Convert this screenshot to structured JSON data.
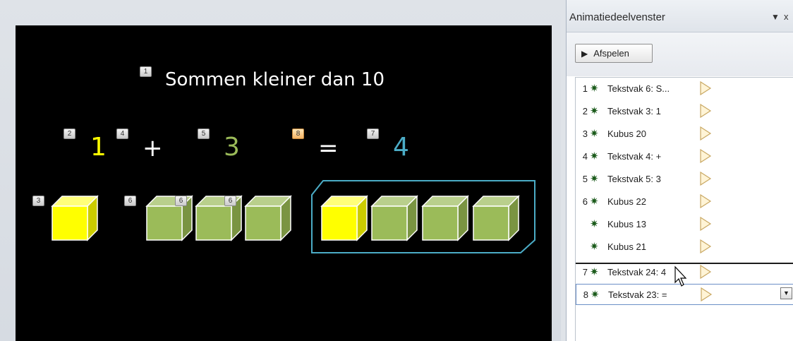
{
  "slide": {
    "title": "Sommen kleiner dan 10",
    "equation": {
      "a": "1",
      "plus": "+",
      "b": "3",
      "equals": "=",
      "result": "4"
    },
    "tags": {
      "t1": "1",
      "t2": "2",
      "t3": "3",
      "t4": "4",
      "t5": "5",
      "t6a": "6",
      "t6b": "6",
      "t6c": "6",
      "t7": "7",
      "t8": "8"
    },
    "colors": {
      "background": "#000000",
      "yellow": "#ffff00",
      "green": "#9bbb59",
      "teal": "#4bacc6"
    }
  },
  "pane": {
    "title": "Animatiedeelvenster",
    "menu_icon": "dropdown-triangle-icon",
    "close_label": "x",
    "play_button": {
      "icon": "play-icon",
      "label": "Afspelen"
    },
    "items": [
      {
        "num": "1",
        "label": "Tekstvak 6: S..."
      },
      {
        "num": "2",
        "label": "Tekstvak 3: 1"
      },
      {
        "num": "3",
        "label": "Kubus 20"
      },
      {
        "num": "4",
        "label": "Tekstvak 4: +"
      },
      {
        "num": "5",
        "label": "Tekstvak 5: 3"
      },
      {
        "num": "6",
        "label": "Kubus 22"
      },
      {
        "num": "",
        "label": "Kubus 13"
      },
      {
        "num": "",
        "label": "Kubus 21"
      },
      {
        "num": "7",
        "label": "Tekstvak 24: 4"
      },
      {
        "num": "8",
        "label": "Tekstvak 23: ="
      }
    ],
    "selected_index": 9,
    "accent": "#6b8fc7"
  }
}
